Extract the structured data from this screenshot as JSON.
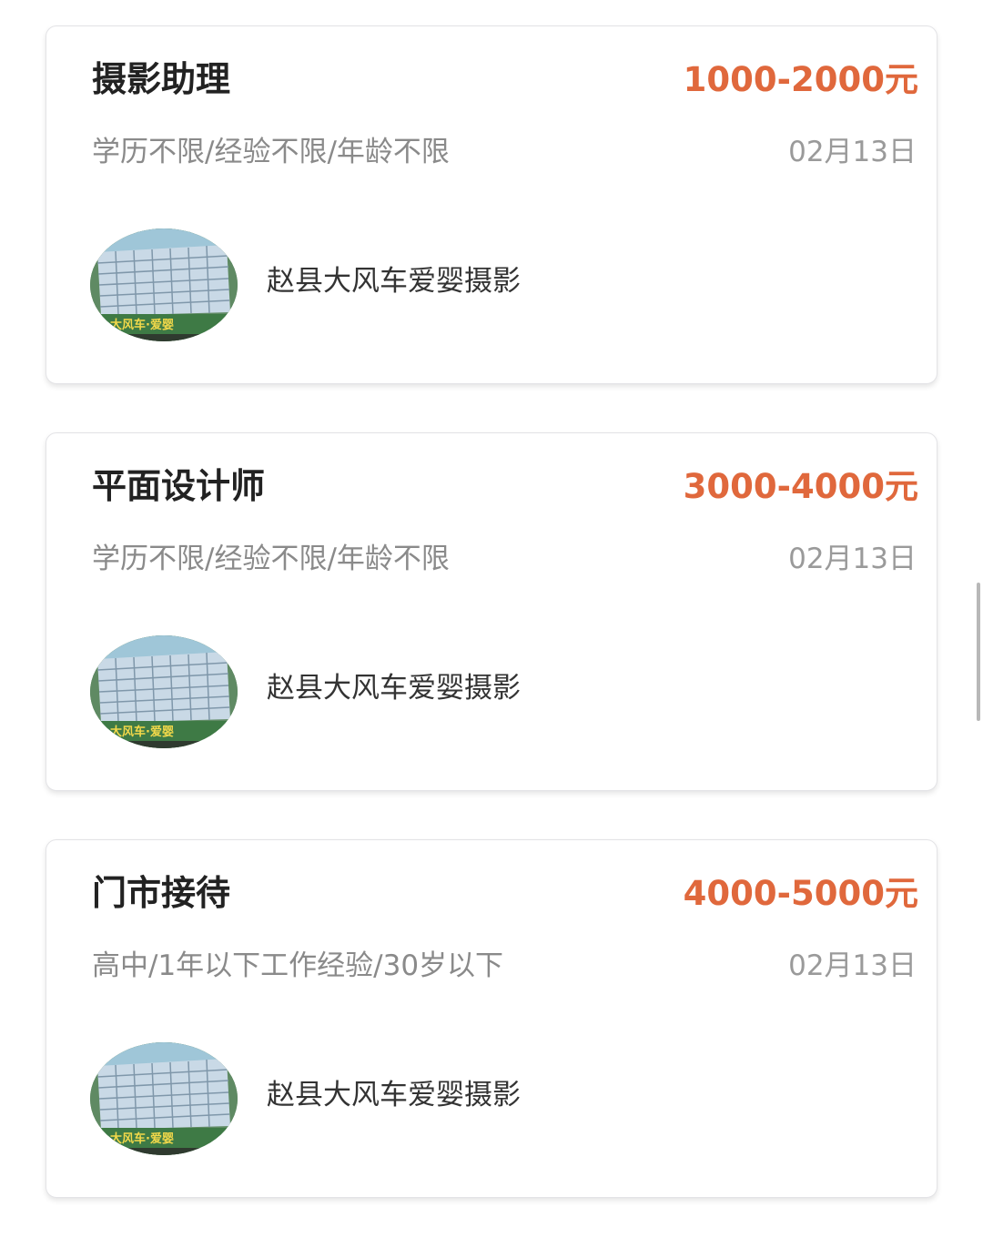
{
  "jobs": [
    {
      "title": "摄影助理",
      "salary": "1000-2000元",
      "requirements": "学历不限/经验不限/年龄不限",
      "date": "02月13日",
      "company": "赵县大风车爱婴摄影"
    },
    {
      "title": "平面设计师",
      "salary": "3000-4000元",
      "requirements": "学历不限/经验不限/年龄不限",
      "date": "02月13日",
      "company": "赵县大风车爱婴摄影"
    },
    {
      "title": "门市接待",
      "salary": "4000-5000元",
      "requirements": "高中/1年以下工作经验/30岁以下",
      "date": "02月13日",
      "company": "赵县大风车爱婴摄影"
    }
  ],
  "colors": {
    "salary": "#e0683c",
    "title": "#222222",
    "secondary_text": "#8a8a8a"
  }
}
